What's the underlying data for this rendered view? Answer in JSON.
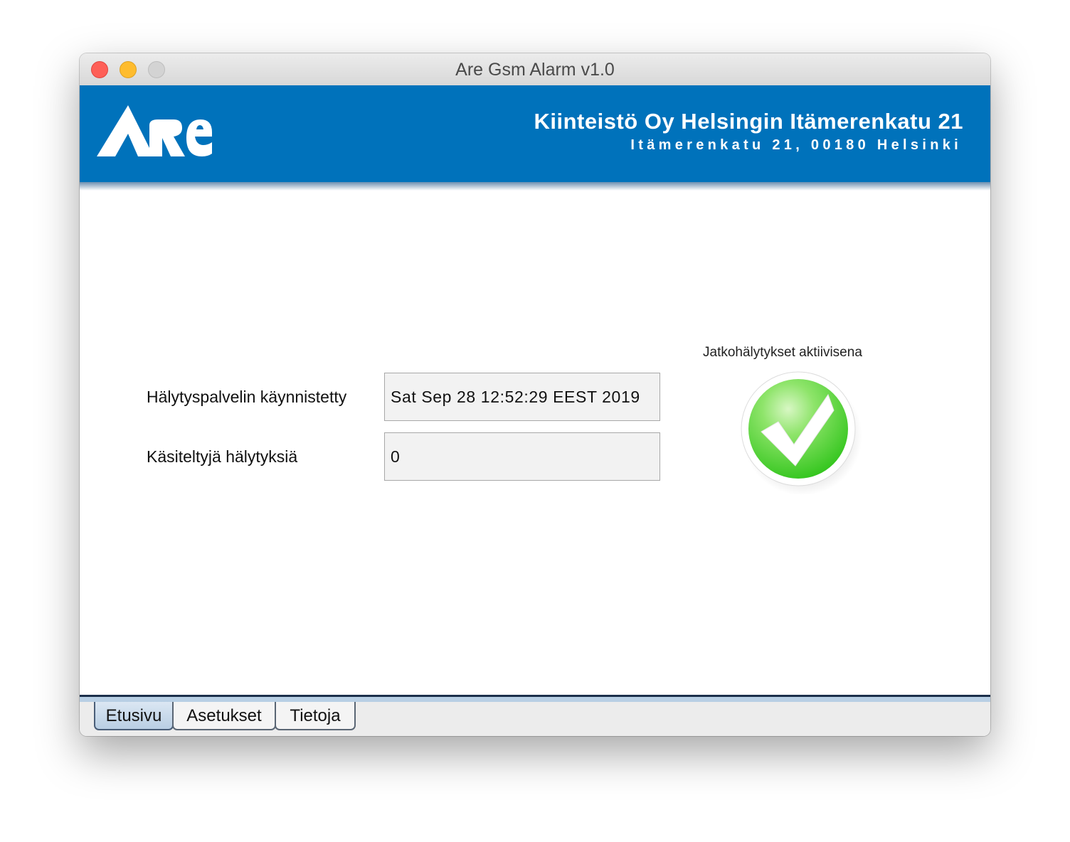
{
  "window": {
    "title": "Are Gsm Alarm v1.0"
  },
  "header": {
    "logo_text": "ARE",
    "company_name": "Kiinteistö Oy Helsingin Itämerenkatu 21",
    "address": "Itämerenkatu 21, 00180 Helsinki"
  },
  "main": {
    "fields": [
      {
        "label": "Hälytyspalvelin käynnistetty",
        "value": "Sat Sep 28 12:52:29 EEST 2019"
      },
      {
        "label": "Käsiteltyjä hälytyksiä",
        "value": "0"
      }
    ],
    "status": {
      "label": "Jatkohälytykset aktiivisena",
      "icon": "checkmark-ok-icon"
    }
  },
  "tabs": [
    {
      "label": "Etusivu",
      "active": true
    },
    {
      "label": "Asetukset",
      "active": false
    },
    {
      "label": "Tietoja",
      "active": false
    }
  ],
  "colors": {
    "banner": "#0072bb",
    "status_ok": "#3fcf2a",
    "active_tab": "#c6d8ea"
  }
}
